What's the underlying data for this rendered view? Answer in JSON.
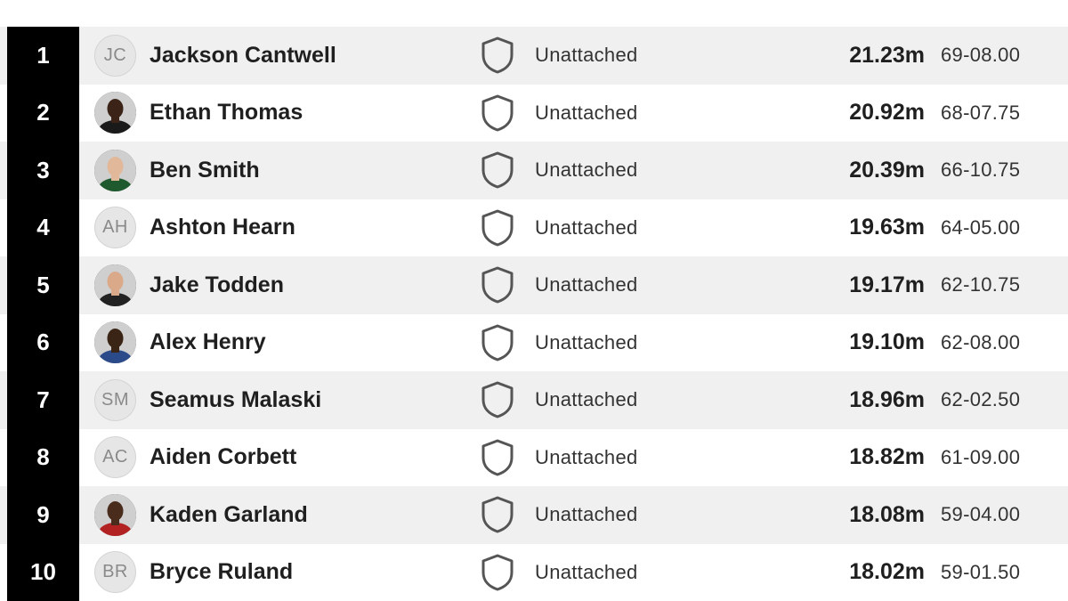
{
  "results": [
    {
      "rank": "1",
      "name": "Jackson Cantwell",
      "avatar": {
        "type": "initials",
        "text": "JC"
      },
      "team": "Unattached",
      "mark": "21.23m",
      "imperial": "69-08.00"
    },
    {
      "rank": "2",
      "name": "Ethan Thomas",
      "avatar": {
        "type": "photo",
        "skin": "#3b2417",
        "shirt": "#1a1a1a"
      },
      "team": "Unattached",
      "mark": "20.92m",
      "imperial": "68-07.75"
    },
    {
      "rank": "3",
      "name": "Ben Smith",
      "avatar": {
        "type": "photo",
        "skin": "#e2b89a",
        "shirt": "#1f5a2e"
      },
      "team": "Unattached",
      "mark": "20.39m",
      "imperial": "66-10.75"
    },
    {
      "rank": "4",
      "name": "Ashton Hearn",
      "avatar": {
        "type": "initials",
        "text": "AH"
      },
      "team": "Unattached",
      "mark": "19.63m",
      "imperial": "64-05.00"
    },
    {
      "rank": "5",
      "name": "Jake Todden",
      "avatar": {
        "type": "photo",
        "skin": "#d9a98a",
        "shirt": "#222222"
      },
      "team": "Unattached",
      "mark": "19.17m",
      "imperial": "62-10.75"
    },
    {
      "rank": "6",
      "name": "Alex Henry",
      "avatar": {
        "type": "photo",
        "skin": "#3a2416",
        "shirt": "#2b4a8a"
      },
      "team": "Unattached",
      "mark": "19.10m",
      "imperial": "62-08.00"
    },
    {
      "rank": "7",
      "name": "Seamus Malaski",
      "avatar": {
        "type": "initials",
        "text": "SM"
      },
      "team": "Unattached",
      "mark": "18.96m",
      "imperial": "62-02.50"
    },
    {
      "rank": "8",
      "name": "Aiden Corbett",
      "avatar": {
        "type": "initials",
        "text": "AC"
      },
      "team": "Unattached",
      "mark": "18.82m",
      "imperial": "61-09.00"
    },
    {
      "rank": "9",
      "name": "Kaden Garland",
      "avatar": {
        "type": "photo",
        "skin": "#4a2c1c",
        "shirt": "#b22222"
      },
      "team": "Unattached",
      "mark": "18.08m",
      "imperial": "59-04.00"
    },
    {
      "rank": "10",
      "name": "Bryce Ruland",
      "avatar": {
        "type": "initials",
        "text": "BR"
      },
      "team": "Unattached",
      "mark": "18.02m",
      "imperial": "59-01.50"
    }
  ],
  "icons": {
    "team_logo": "shield-outline-icon"
  },
  "colors": {
    "rank_bg": "#000000",
    "row_alt": "#f0f0f0",
    "row_base": "#ffffff",
    "shield_stroke": "#555555"
  }
}
